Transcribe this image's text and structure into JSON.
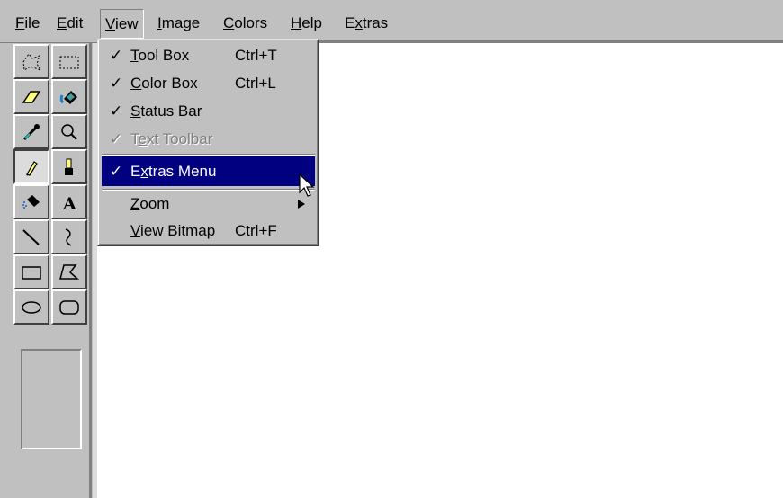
{
  "menubar": {
    "items": [
      {
        "label": "File",
        "underline": "F",
        "rest": "ile"
      },
      {
        "label": "Edit",
        "underline": "E",
        "rest": "dit"
      },
      {
        "label": "View",
        "underline": "V",
        "rest": "iew"
      },
      {
        "label": "Image",
        "underline": "I",
        "rest": "mage"
      },
      {
        "label": "Colors",
        "underline": "C",
        "rest": "olors"
      },
      {
        "label": "Help",
        "underline": "H",
        "rest": "elp"
      },
      {
        "label": "Extras",
        "pre": "E",
        "underline": "x",
        "rest": "tras"
      }
    ]
  },
  "view_menu": {
    "items": [
      {
        "check": "✓",
        "pre": "",
        "underline": "T",
        "rest": "ool Box",
        "shortcut": "Ctrl+T"
      },
      {
        "check": "✓",
        "pre": "",
        "underline": "C",
        "rest": "olor Box",
        "shortcut": "Ctrl+L"
      },
      {
        "check": "✓",
        "pre": "",
        "underline": "S",
        "rest": "tatus Bar",
        "shortcut": ""
      },
      {
        "check": "✓",
        "pre": "T",
        "underline": "e",
        "rest": "xt Toolbar",
        "shortcut": ""
      },
      {
        "check": "✓",
        "pre": "E",
        "underline": "x",
        "rest": "tras Menu",
        "shortcut": ""
      },
      {
        "check": "",
        "pre": "",
        "underline": "Z",
        "rest": "oom",
        "shortcut": ""
      },
      {
        "check": "",
        "pre": "",
        "underline": "V",
        "rest": "iew Bitmap",
        "shortcut": "Ctrl+F"
      }
    ]
  },
  "tools": [
    "free-select-icon",
    "rect-select-icon",
    "eraser-icon",
    "fill-bucket-icon",
    "color-picker-icon",
    "magnifier-icon",
    "pencil-icon",
    "brush-icon",
    "airbrush-icon",
    "text-icon",
    "line-icon",
    "curve-icon",
    "rectangle-icon",
    "polygon-icon",
    "ellipse-icon",
    "rounded-rect-icon"
  ],
  "colors": {
    "menu_bg": "#c0c0c0",
    "highlight": "#000080",
    "canvas": "#ffffff"
  }
}
